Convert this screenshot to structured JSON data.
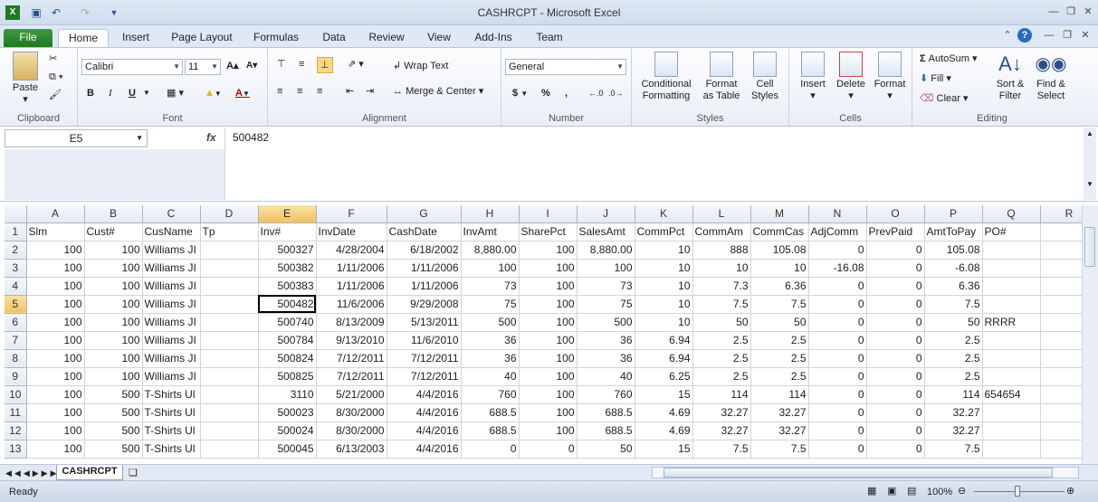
{
  "window": {
    "title": "CASHRCPT - Microsoft Excel"
  },
  "tabs": [
    "File",
    "Home",
    "Insert",
    "Page Layout",
    "Formulas",
    "Data",
    "Review",
    "View",
    "Add-Ins",
    "Team"
  ],
  "ribbon": {
    "clipboard": {
      "label": "Clipboard",
      "paste": "Paste"
    },
    "font": {
      "label": "Font",
      "name": "Calibri",
      "size": "11",
      "bold": "B",
      "italic": "I",
      "underline": "U"
    },
    "alignment": {
      "label": "Alignment",
      "wrap": "Wrap Text",
      "merge": "Merge & Center"
    },
    "number": {
      "label": "Number",
      "format": "General",
      "currency": "$",
      "percent": "%",
      "comma": ","
    },
    "styles": {
      "label": "Styles",
      "conditional": "Conditional\nFormatting",
      "format_table": "Format\nas Table",
      "cell_styles": "Cell\nStyles"
    },
    "cells": {
      "label": "Cells",
      "insert": "Insert",
      "delete": "Delete",
      "format": "Format"
    },
    "editing": {
      "label": "Editing",
      "autosum": "AutoSum",
      "fill": "Fill",
      "clear": "Clear",
      "sort": "Sort &\nFilter",
      "find": "Find &\nSelect"
    }
  },
  "formula_bar": {
    "name_box": "E5",
    "fx": "fx",
    "content": "500482"
  },
  "columns": [
    "A",
    "B",
    "C",
    "D",
    "E",
    "F",
    "G",
    "H",
    "I",
    "J",
    "K",
    "L",
    "M",
    "N",
    "O",
    "P",
    "Q",
    "R"
  ],
  "rows": [
    {
      "n": "1",
      "c": [
        "Slm",
        "Cust#",
        "CusName",
        "Tp",
        "Inv#",
        "InvDate",
        "CashDate",
        "InvAmt",
        "SharePct",
        "SalesAmt",
        "CommPct",
        "CommAm",
        "CommCas",
        "AdjComm",
        "PrevPaid",
        "AmtToPay",
        "PO#",
        ""
      ]
    },
    {
      "n": "2",
      "c": [
        "100",
        "100",
        "Williams JI",
        "",
        "500327",
        "4/28/2004",
        "6/18/2002",
        "8,880.00",
        "100",
        "8,880.00",
        "10",
        "888",
        "105.08",
        "0",
        "0",
        "105.08",
        "",
        ""
      ]
    },
    {
      "n": "3",
      "c": [
        "100",
        "100",
        "Williams JI",
        "",
        "500382",
        "1/11/2006",
        "1/11/2006",
        "100",
        "100",
        "100",
        "10",
        "10",
        "10",
        "-16.08",
        "0",
        "-6.08",
        "",
        ""
      ]
    },
    {
      "n": "4",
      "c": [
        "100",
        "100",
        "Williams JI",
        "",
        "500383",
        "1/11/2006",
        "1/11/2006",
        "73",
        "100",
        "73",
        "10",
        "7.3",
        "6.36",
        "0",
        "0",
        "6.36",
        "",
        ""
      ]
    },
    {
      "n": "5",
      "c": [
        "100",
        "100",
        "Williams JI",
        "",
        "500482",
        "11/6/2006",
        "9/29/2008",
        "75",
        "100",
        "75",
        "10",
        "7.5",
        "7.5",
        "0",
        "0",
        "7.5",
        "",
        ""
      ]
    },
    {
      "n": "6",
      "c": [
        "100",
        "100",
        "Williams JI",
        "",
        "500740",
        "8/13/2009",
        "5/13/2011",
        "500",
        "100",
        "500",
        "10",
        "50",
        "50",
        "0",
        "0",
        "50",
        "RRRR",
        ""
      ]
    },
    {
      "n": "7",
      "c": [
        "100",
        "100",
        "Williams JI",
        "",
        "500784",
        "9/13/2010",
        "11/6/2010",
        "36",
        "100",
        "36",
        "6.94",
        "2.5",
        "2.5",
        "0",
        "0",
        "2.5",
        "",
        ""
      ]
    },
    {
      "n": "8",
      "c": [
        "100",
        "100",
        "Williams JI",
        "",
        "500824",
        "7/12/2011",
        "7/12/2011",
        "36",
        "100",
        "36",
        "6.94",
        "2.5",
        "2.5",
        "0",
        "0",
        "2.5",
        "",
        ""
      ]
    },
    {
      "n": "9",
      "c": [
        "100",
        "100",
        "Williams JI",
        "",
        "500825",
        "7/12/2011",
        "7/12/2011",
        "40",
        "100",
        "40",
        "6.25",
        "2.5",
        "2.5",
        "0",
        "0",
        "2.5",
        "",
        ""
      ]
    },
    {
      "n": "10",
      "c": [
        "100",
        "500",
        "T-Shirts Ul",
        "",
        "3110",
        "5/21/2000",
        "4/4/2016",
        "760",
        "100",
        "760",
        "15",
        "114",
        "114",
        "0",
        "0",
        "114",
        "654654",
        ""
      ]
    },
    {
      "n": "11",
      "c": [
        "100",
        "500",
        "T-Shirts Ul",
        "",
        "500023",
        "8/30/2000",
        "4/4/2016",
        "688.5",
        "100",
        "688.5",
        "4.69",
        "32.27",
        "32.27",
        "0",
        "0",
        "32.27",
        "",
        ""
      ]
    },
    {
      "n": "12",
      "c": [
        "100",
        "500",
        "T-Shirts Ul",
        "",
        "500024",
        "8/30/2000",
        "4/4/2016",
        "688.5",
        "100",
        "688.5",
        "4.69",
        "32.27",
        "32.27",
        "0",
        "0",
        "32.27",
        "",
        ""
      ]
    },
    {
      "n": "13",
      "c": [
        "100",
        "500",
        "T-Shirts Ul",
        "",
        "500045",
        "6/13/2003",
        "4/4/2016",
        "0",
        "0",
        "50",
        "15",
        "7.5",
        "7.5",
        "0",
        "0",
        "7.5",
        "",
        ""
      ]
    }
  ],
  "sheet_tab": "CASHRCPT",
  "status": {
    "ready": "Ready",
    "zoom": "100%"
  }
}
